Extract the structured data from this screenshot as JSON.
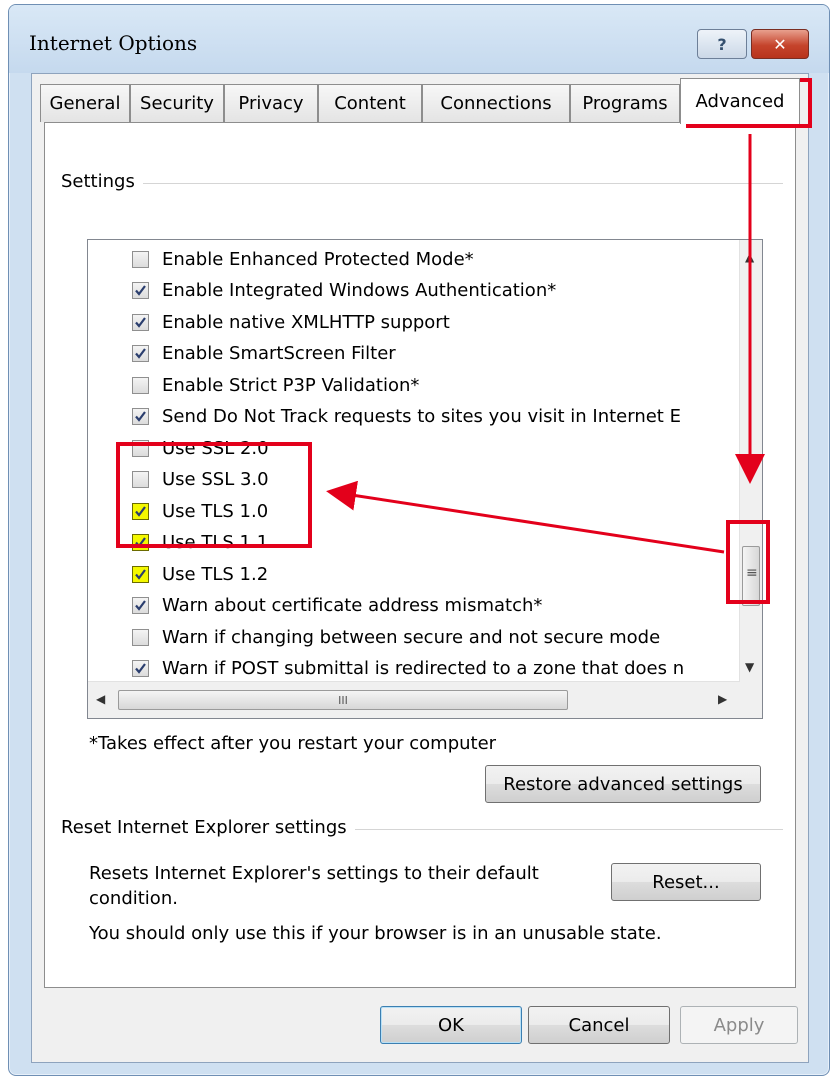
{
  "window": {
    "title": "Internet Options",
    "help_label": "?",
    "close_label": "✕"
  },
  "tabs": [
    {
      "label": "General"
    },
    {
      "label": "Security"
    },
    {
      "label": "Privacy"
    },
    {
      "label": "Content"
    },
    {
      "label": "Connections"
    },
    {
      "label": "Programs"
    },
    {
      "label": "Advanced",
      "active": true
    }
  ],
  "settings": {
    "group_label": "Settings",
    "options": [
      {
        "label": "Enable Enhanced Protected Mode*",
        "checked": false
      },
      {
        "label": "Enable Integrated Windows Authentication*",
        "checked": true
      },
      {
        "label": "Enable native XMLHTTP support",
        "checked": true
      },
      {
        "label": "Enable SmartScreen Filter",
        "checked": true
      },
      {
        "label": "Enable Strict P3P Validation*",
        "checked": false
      },
      {
        "label": "Send Do Not Track requests to sites you visit in Internet E",
        "checked": true
      },
      {
        "label": "Use SSL 2.0",
        "checked": false
      },
      {
        "label": "Use SSL 3.0",
        "checked": false
      },
      {
        "label": "Use TLS 1.0",
        "checked": true,
        "highlighted": true
      },
      {
        "label": "Use TLS 1.1",
        "checked": true,
        "highlighted": true
      },
      {
        "label": "Use TLS 1.2",
        "checked": true,
        "highlighted": true
      },
      {
        "label": "Warn about certificate address mismatch*",
        "checked": true
      },
      {
        "label": "Warn if changing between secure and not secure mode",
        "checked": false
      },
      {
        "label": "Warn if POST submittal is redirected to a zone that does n",
        "checked": true
      }
    ],
    "hscroll_thumb_glyph": "III",
    "vscroll_thumb_glyph": "≡",
    "restart_note": "*Takes effect after you restart your computer",
    "restore_label": "Restore advanced settings"
  },
  "reset": {
    "group_label": "Reset Internet Explorer settings",
    "description": "Resets Internet Explorer's settings to their default condition.",
    "button_label": "Reset...",
    "warning": "You should only use this if your browser is in an unusable state."
  },
  "footer": {
    "ok_label": "OK",
    "cancel_label": "Cancel",
    "apply_label": "Apply"
  },
  "annotation_color": "#e3001b",
  "highlight_color": "#f4f800"
}
